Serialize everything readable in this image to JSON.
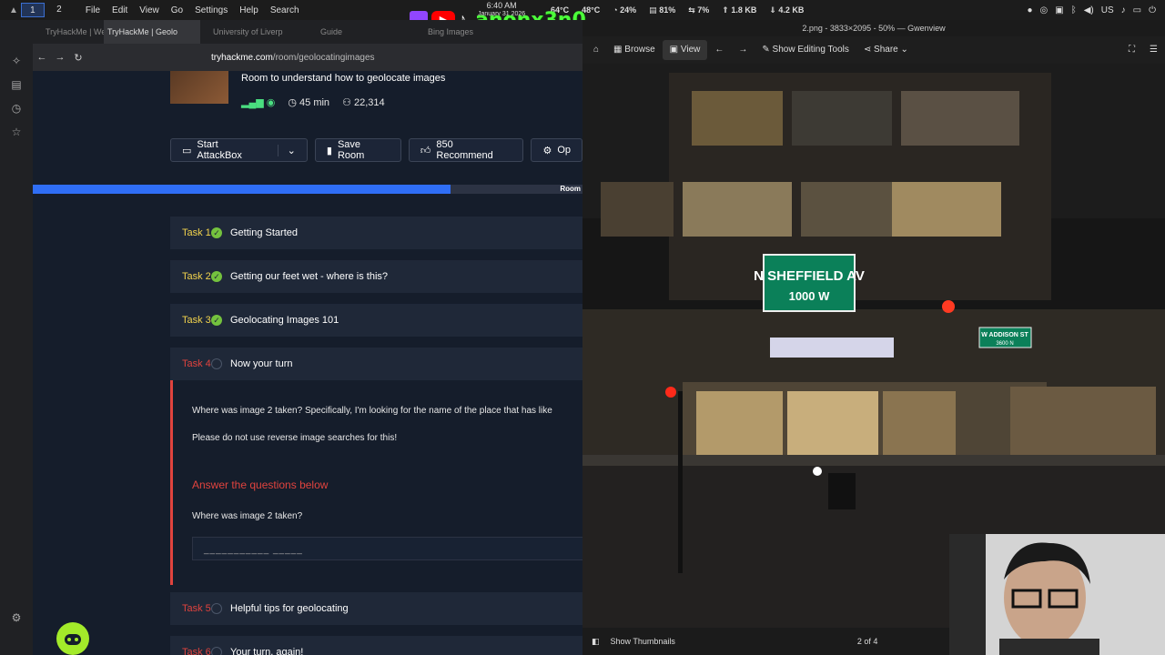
{
  "topbar": {
    "workspaces": [
      "1",
      "2"
    ],
    "menu": [
      "File",
      "Edit",
      "View",
      "Go",
      "Settings",
      "Help",
      "Search"
    ],
    "time": "6:40 AM",
    "date": "January 31 2026",
    "temp1": "64°C",
    "temp2": "48°C",
    "cpu": "24%",
    "mem": "81%",
    "swap": "7%",
    "up": "1.8 KB",
    "down": "4.2 KB",
    "lang": "US"
  },
  "overlay": {
    "handle": "anonx3n0"
  },
  "browser": {
    "tabs": [
      "TryHackMe | Weath",
      "TryHackMe | Geolo",
      "University of Liverp",
      "Guide",
      "Bing Images"
    ],
    "url_domain": "tryhackme.com",
    "url_path": "/room/geolocatingimages"
  },
  "room": {
    "description": "Room to understand how to geolocate images",
    "duration": "45 min",
    "users": "22,314",
    "buttons": {
      "attackbox": "Start AttackBox",
      "save": "Save Room",
      "recommend": "850 Recommend",
      "options": "Op"
    },
    "progress_label": "Room",
    "progress": 0.76
  },
  "tasks": [
    {
      "num": "Task 1",
      "title": "Getting Started",
      "done": true
    },
    {
      "num": "Task 2",
      "title": "Getting our feet wet - where is this?",
      "done": true
    },
    {
      "num": "Task 3",
      "title": "Geolocating Images 101",
      "done": true
    },
    {
      "num": "Task 4",
      "title": "Now your turn",
      "done": false
    },
    {
      "num": "Task 5",
      "title": "Helpful tips for geolocating",
      "done": false
    },
    {
      "num": "Task 6",
      "title": "Your turn, again!",
      "done": false
    }
  ],
  "task4": {
    "question_text": "Where was image 2 taken? Specifically, I'm looking for the name of the place that has like",
    "note": "Please do not use reverse image searches for this!",
    "answer_heading": "Answer the questions below",
    "question_label": "Where was image 2 taken?",
    "answer_placeholder": "___________ _____"
  },
  "viewer": {
    "title": "2.png - 3833×2095 - 50% — Gwenview",
    "browse": "Browse",
    "view": "View",
    "editing": "Show Editing Tools",
    "share": "Share",
    "thumbnails": "Show Thumbnails",
    "page": "2 of 4",
    "sign_main": "N SHEFFIELD AV",
    "sign_sub": "1000 W",
    "sign_side": "W ADDISON ST",
    "sign_side_sub": "3600 N"
  }
}
